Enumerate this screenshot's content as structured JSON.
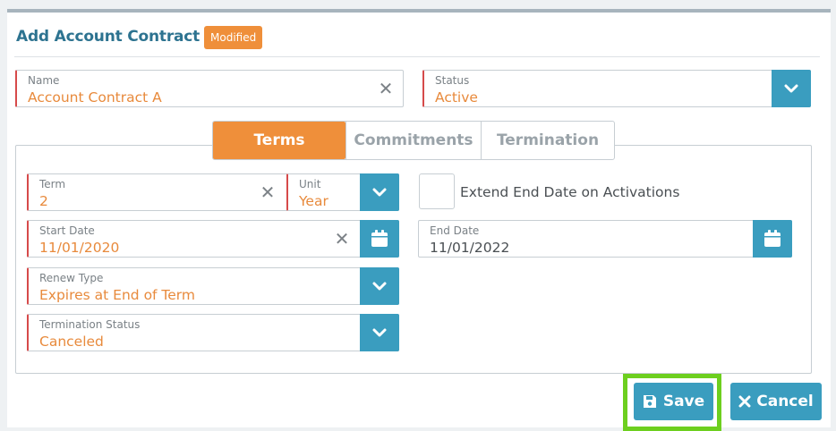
{
  "dialog": {
    "title": "Add Account Contract",
    "badge": "Modified"
  },
  "fields": {
    "name": {
      "label": "Name",
      "value": "Account Contract A"
    },
    "status": {
      "label": "Status",
      "value": "Active"
    },
    "term": {
      "label": "Term",
      "value": "2"
    },
    "unit": {
      "label": "Unit",
      "value": "Year"
    },
    "start_date": {
      "label": "Start Date",
      "value": "11/01/2020"
    },
    "end_date": {
      "label": "End Date",
      "value": "11/01/2022"
    },
    "renew_type": {
      "label": "Renew Type",
      "value": "Expires at End of Term"
    },
    "termination_status": {
      "label": "Termination Status",
      "value": "Canceled"
    },
    "extend_end_date": {
      "label": "Extend End Date on Activations",
      "checked": false
    }
  },
  "tabs": [
    {
      "label": "Terms",
      "active": true
    },
    {
      "label": "Commitments",
      "active": false
    },
    {
      "label": "Termination",
      "active": false
    }
  ],
  "actions": {
    "save": "Save",
    "cancel": "Cancel"
  },
  "colors": {
    "accent": "#3a9dbf",
    "orange": "#ef8f3a",
    "highlight": "#6dcf1f",
    "required": "#d64a4a",
    "title": "#2d7390"
  },
  "icons": [
    "clear-icon",
    "chevron-down-icon",
    "calendar-icon",
    "save-disk-icon",
    "close-icon"
  ]
}
